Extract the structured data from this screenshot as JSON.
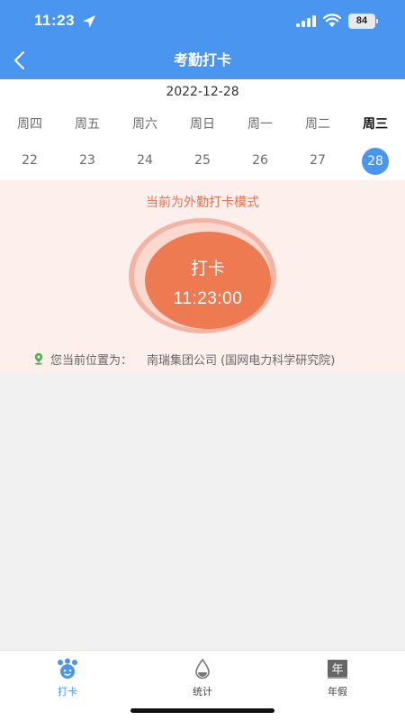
{
  "status_bar": {
    "time": "11:23",
    "battery": "84"
  },
  "header": {
    "title": "考勤打卡",
    "back_icon": "chevron-left-icon"
  },
  "calendar": {
    "date": "2022-12-28",
    "weekdays": [
      "周四",
      "周五",
      "周六",
      "周日",
      "周一",
      "周二",
      "周三"
    ],
    "days": [
      "22",
      "23",
      "24",
      "25",
      "26",
      "27",
      "28"
    ],
    "selected_day": "28"
  },
  "checkin": {
    "mode_text": "当前为外勤打卡模式",
    "button_label": "打卡",
    "time": "11:23:00",
    "location_prefix": "您当前位置为：",
    "location_value": "南瑞集团公司 (国网电力科学研究院)"
  },
  "tabs": [
    {
      "label": "打卡",
      "icon": "checkin-icon",
      "active": true
    },
    {
      "label": "统计",
      "icon": "droplet-icon",
      "active": false
    },
    {
      "label": "年假",
      "icon": "calendar-year-icon",
      "active": false
    }
  ],
  "tab_icon_text": {
    "annual_leave": "年"
  },
  "colors": {
    "header": "#4a95f0",
    "accent_orange": "#ee7a52",
    "panel_background": "#fdefec",
    "selected_day": "#4a95f0",
    "location_pin": "#4caf50"
  }
}
